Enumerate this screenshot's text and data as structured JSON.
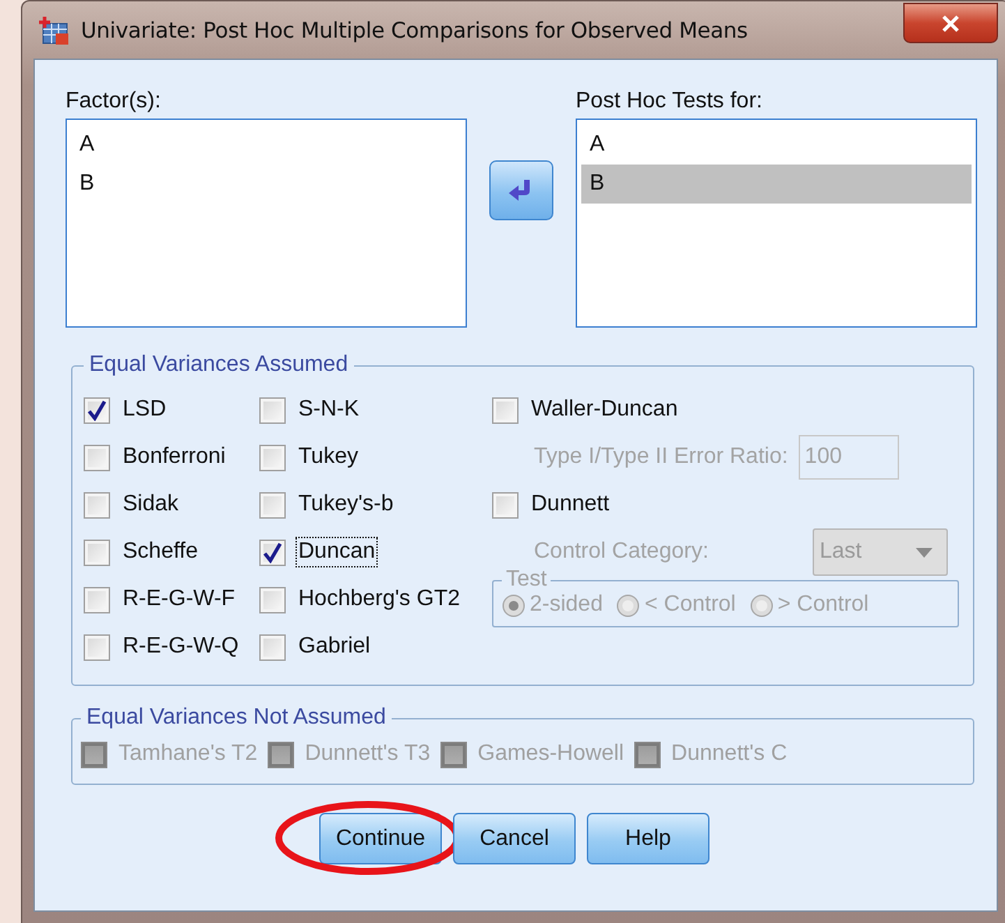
{
  "window": {
    "title": "Univariate: Post Hoc Multiple Comparisons for Observed Means"
  },
  "factors": {
    "label": "Factor(s):",
    "items": [
      {
        "label": "A",
        "selected": false
      },
      {
        "label": "B",
        "selected": false
      }
    ]
  },
  "post_hoc_tests_for": {
    "label": "Post Hoc Tests for:",
    "items": [
      {
        "label": "A",
        "selected": false
      },
      {
        "label": "B",
        "selected": true
      }
    ]
  },
  "equal_variances_assumed": {
    "title": "Equal Variances Assumed",
    "column_1": [
      {
        "label": "LSD",
        "checked": true,
        "focused": false
      },
      {
        "label": "Bonferroni",
        "checked": false,
        "focused": false
      },
      {
        "label": "Sidak",
        "checked": false,
        "focused": false
      },
      {
        "label": "Scheffe",
        "checked": false,
        "focused": false
      },
      {
        "label": "R-E-G-W-F",
        "checked": false,
        "focused": false
      },
      {
        "label": "R-E-G-W-Q",
        "checked": false,
        "focused": false
      }
    ],
    "column_2": [
      {
        "label": "S-N-K",
        "checked": false,
        "focused": false
      },
      {
        "label": "Tukey",
        "checked": false,
        "focused": false
      },
      {
        "label": "Tukey's-b",
        "checked": false,
        "focused": false
      },
      {
        "label": "Duncan",
        "checked": true,
        "focused": true
      },
      {
        "label": "Hochberg's GT2",
        "checked": false,
        "focused": false
      },
      {
        "label": "Gabriel",
        "checked": false,
        "focused": false
      }
    ],
    "waller_duncan": {
      "label": "Waller-Duncan",
      "checked": false
    },
    "error_ratio": {
      "label": "Type I/Type II Error Ratio:",
      "value": "100",
      "disabled": true
    },
    "dunnett": {
      "label": "Dunnett",
      "checked": false
    },
    "control_category": {
      "label": "Control Category:",
      "value": "Last",
      "disabled": true
    },
    "test": {
      "title": "Test",
      "disabled": true,
      "options": [
        {
          "label": "2-sided",
          "selected": true
        },
        {
          "label": "< Control",
          "selected": false
        },
        {
          "label": "> Control",
          "selected": false
        }
      ]
    }
  },
  "equal_variances_not_assumed": {
    "title": "Equal Variances Not Assumed",
    "items": [
      {
        "label": "Tamhane's T2",
        "checked": false,
        "disabled": true
      },
      {
        "label": "Dunnett's T3",
        "checked": false,
        "disabled": true
      },
      {
        "label": "Games-Howell",
        "checked": false,
        "disabled": true
      },
      {
        "label": "Dunnett's C",
        "checked": false,
        "disabled": true
      }
    ]
  },
  "buttons": [
    {
      "label": "Continue",
      "circled": true
    },
    {
      "label": "Cancel",
      "circled": false
    },
    {
      "label": "Help",
      "circled": false
    }
  ]
}
